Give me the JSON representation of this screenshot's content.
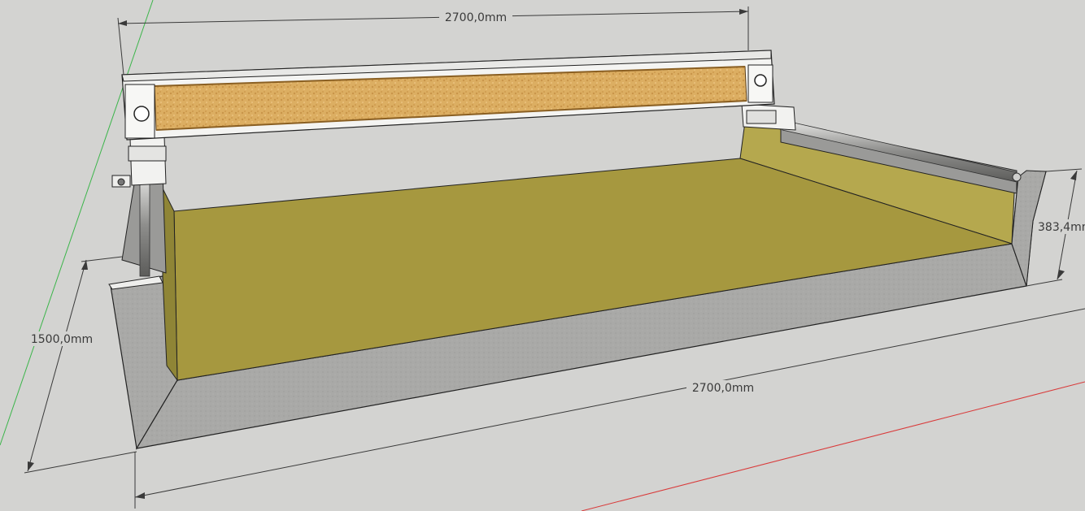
{
  "dimensions": {
    "top_width": "2700,0mm",
    "bottom_width": "2700,0mm",
    "depth": "1500,0mm",
    "height": "383,4mm"
  },
  "colors": {
    "background": "#d3d3d1",
    "concrete": "#a9a9a7",
    "bed_floor": "#a6983f",
    "bed_wall": "#b5a84e",
    "gantry_panel": "#d9a95a",
    "gantry_frame": "#f4f4f2",
    "rail": "#8a8a88",
    "axis_green": "#3bb54a",
    "axis_red": "#d93a3a"
  }
}
